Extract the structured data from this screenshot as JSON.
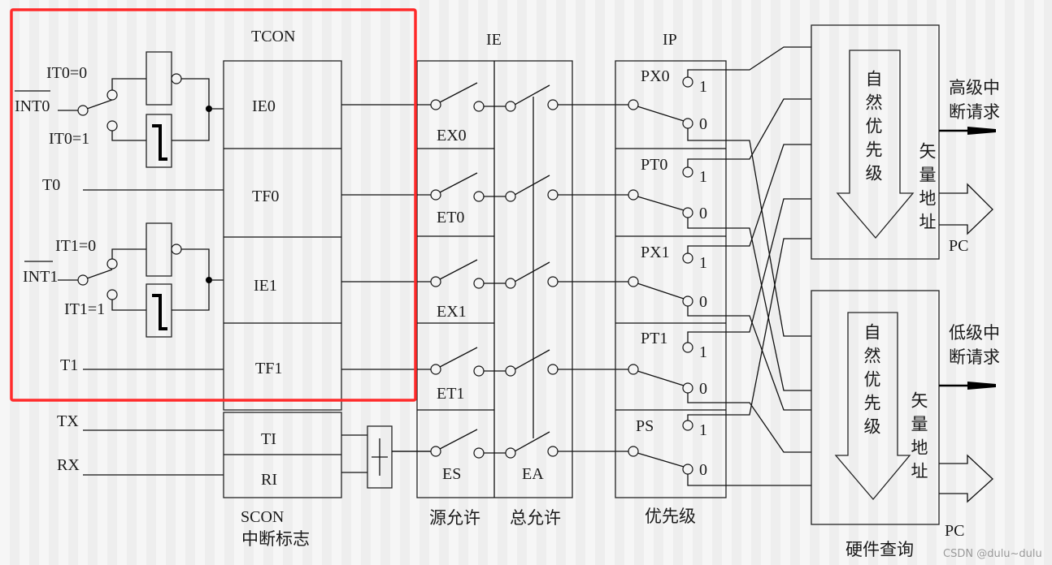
{
  "left": {
    "int0": "INT0",
    "it0_0": "IT0=0",
    "it0_1": "IT0=1",
    "t0": "T0",
    "int1": "INT1",
    "it1_0": "IT1=0",
    "it1_1": "IT1=1",
    "t1": "T1",
    "tx": "TX",
    "rx": "RX"
  },
  "tcon": {
    "title": "TCON",
    "flags": [
      "IE0",
      "TF0",
      "IE1",
      "TF1"
    ]
  },
  "scon": {
    "title": "SCON",
    "caption": "中断标志",
    "flags": [
      "TI",
      "RI"
    ]
  },
  "ie": {
    "title": "IE",
    "bits": [
      "EX0",
      "ET0",
      "EX1",
      "ET1",
      "ES"
    ],
    "ea": "EA",
    "source_caption": "源允许",
    "global_caption": "总允许"
  },
  "ip": {
    "title": "IP",
    "bits": [
      "PX0",
      "PT0",
      "PX1",
      "PT1",
      "PS"
    ],
    "one": "1",
    "zero": "0",
    "caption": "优先级"
  },
  "high": {
    "request_line1": "高级中",
    "request_line2": "断请求",
    "natural": "自然优先级",
    "vector": "矢量地址",
    "pc": "PC"
  },
  "low": {
    "request_line1": "低级中",
    "request_line2": "断请求",
    "natural": "自然优先级",
    "vector": "矢量地址",
    "pc": "PC"
  },
  "hardware_query": "硬件查询",
  "watermark": "CSDN @dulu~dulu",
  "colors": {
    "highlight": "#ff2a2a",
    "line": "#111111",
    "background": "#f3f3f3"
  }
}
